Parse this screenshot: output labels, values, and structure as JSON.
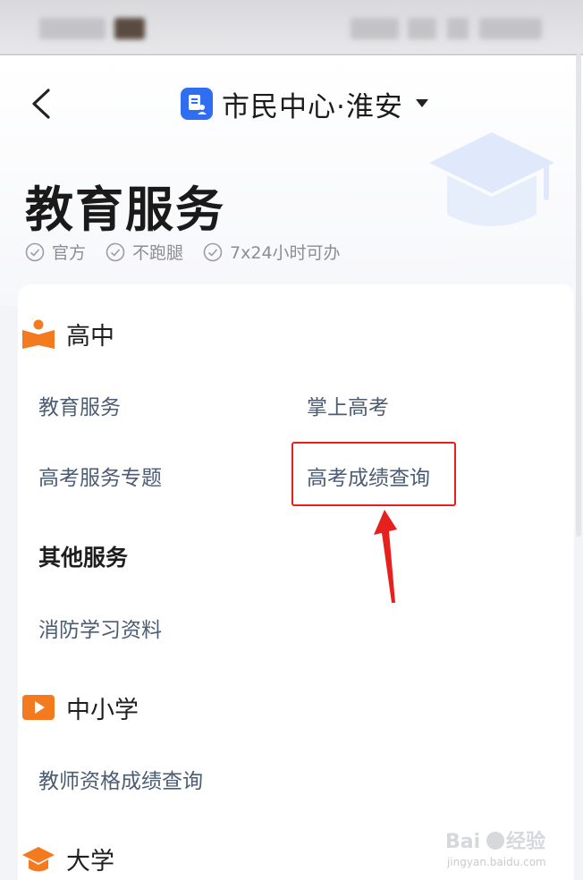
{
  "header": {
    "title": "市民中心·淮安",
    "page_title": "教育服务"
  },
  "tags": [
    {
      "label": "官方"
    },
    {
      "label": "不跑腿"
    },
    {
      "label": "7x24小时可办"
    }
  ],
  "sections": {
    "high_school": {
      "title": "高中",
      "items": [
        "教育服务",
        "掌上高考",
        "高考服务专题",
        "高考成绩查询"
      ]
    },
    "other": {
      "title": "其他服务",
      "items": [
        "消防学习资料"
      ]
    },
    "primary": {
      "title": "中小学",
      "items": [
        "教师资格成绩查询"
      ]
    },
    "university": {
      "title": "大学"
    }
  },
  "watermark": {
    "brand": "Bai",
    "brand2": "经验",
    "url": "jingyan.baidu.com"
  },
  "colors": {
    "accent": "#2f6ef2",
    "orange": "#f47a1f",
    "highlight": "#e8201d",
    "link": "#4b5c73"
  }
}
